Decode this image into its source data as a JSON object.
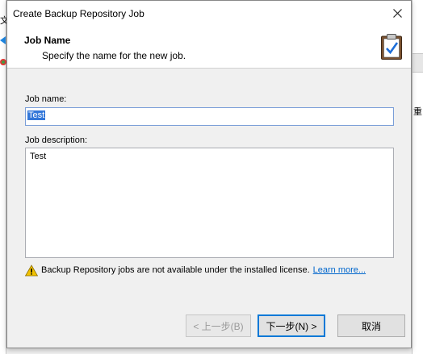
{
  "window": {
    "title": "Create Backup Repository Job"
  },
  "header": {
    "title": "Job Name",
    "subtitle": "Specify the name for the new job."
  },
  "form": {
    "job_name_label": "Job name:",
    "job_name_value": "Test",
    "job_description_label": "Job description:",
    "job_description_value": "Test"
  },
  "warning": {
    "text": "Backup Repository jobs are not available under the installed license.",
    "link": "Learn more..."
  },
  "buttons": {
    "back": "< 上一步(B)",
    "next": "下一步(N) >",
    "cancel": "取消"
  },
  "background": {
    "left_glyph": "文",
    "right_glyph": "重"
  },
  "colors": {
    "accent": "#0078d7",
    "selection": "#3377d9",
    "link": "#0066cc",
    "warning": "#f2c200"
  }
}
